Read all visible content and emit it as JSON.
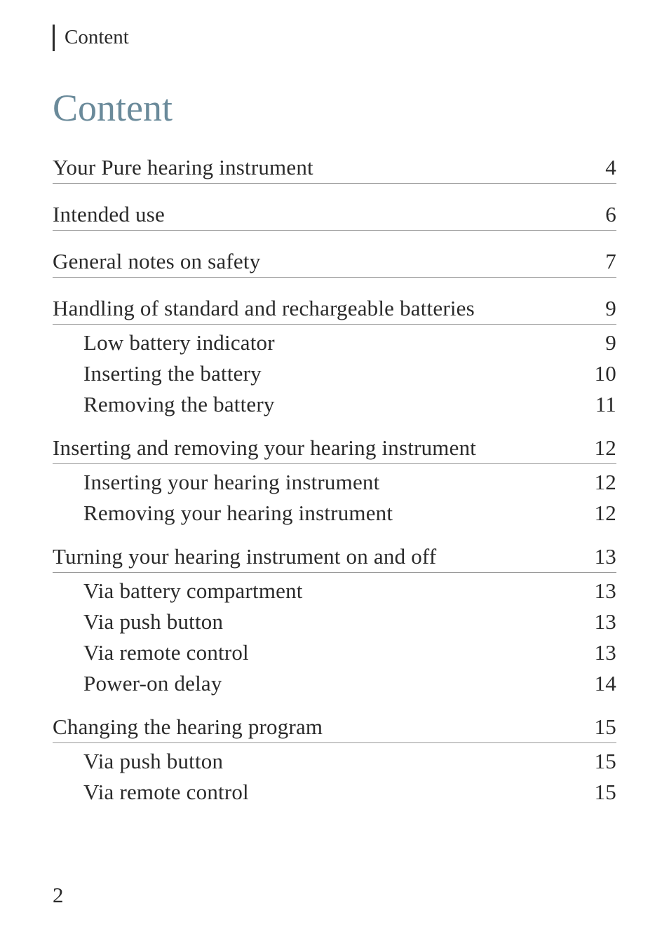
{
  "running_head": "Content",
  "page_title": "Content",
  "page_number": "2",
  "toc": [
    {
      "title": "Your Pure hearing instrument",
      "page": "4",
      "subs": []
    },
    {
      "title": "Intended use",
      "page": "6",
      "subs": []
    },
    {
      "title": "General notes on safety",
      "page": "7",
      "subs": []
    },
    {
      "title": "Handling of standard and rechargeable batteries",
      "page": "9",
      "subs": [
        {
          "title": "Low battery indicator",
          "page": "9"
        },
        {
          "title": "Inserting the battery",
          "page": "10"
        },
        {
          "title": "Removing the battery",
          "page": "11"
        }
      ]
    },
    {
      "title": "Inserting and removing your hearing instrument",
      "page": "12",
      "subs": [
        {
          "title": "Inserting your hearing instrument",
          "page": "12"
        },
        {
          "title": "Removing your hearing instrument",
          "page": "12"
        }
      ]
    },
    {
      "title": "Turning your hearing instrument on and off",
      "page": "13",
      "subs": [
        {
          "title": "Via battery compartment",
          "page": "13"
        },
        {
          "title": "Via push button",
          "page": "13"
        },
        {
          "title": "Via remote control",
          "page": "13"
        },
        {
          "title": "Power-on delay",
          "page": "14"
        }
      ]
    },
    {
      "title": "Changing the hearing program",
      "page": "15",
      "subs": [
        {
          "title": "Via push button",
          "page": "15"
        },
        {
          "title": "Via remote control",
          "page": "15"
        }
      ]
    }
  ]
}
